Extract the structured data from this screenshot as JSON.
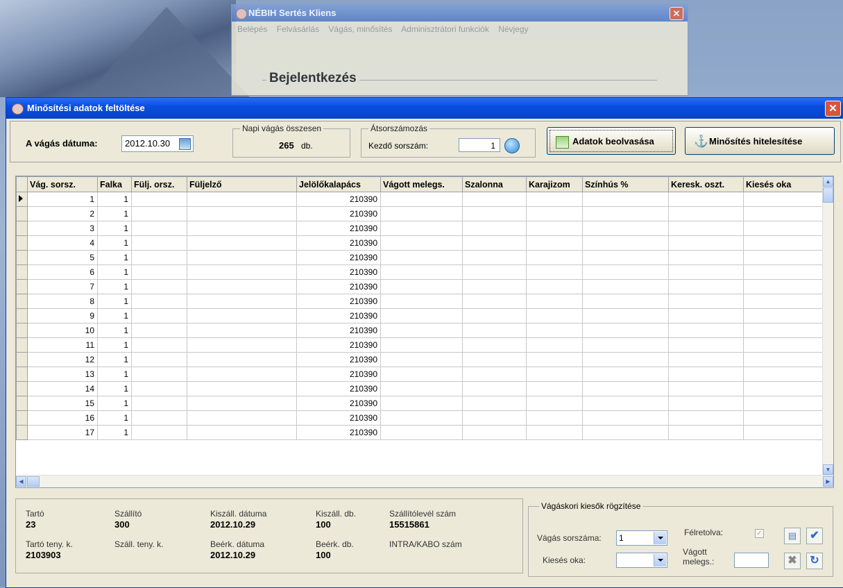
{
  "bg_window": {
    "title": "NÉBIH Sertés Kliens",
    "menu": [
      "Belépés",
      "Felvásárlás",
      "Vágás, minősítés",
      "Adminisztrátori funkciók",
      "Névjegy"
    ],
    "login_title": "Bejelentkezés",
    "close": "✕"
  },
  "window": {
    "title": "Minősítési adatok feltöltése",
    "close": "✕"
  },
  "toolbar": {
    "date_label": "A vágás dátuma:",
    "date_value": "2012.10.30",
    "daily_title": "Napi vágás összesen",
    "daily_value": "265",
    "daily_unit": "db.",
    "renum_title": "Átsorszámozás",
    "start_label": "Kezdő sorszám:",
    "start_value": "1",
    "read_button": "Adatok beolvasása",
    "auth_button": "Minősítés hitelesítése"
  },
  "grid": {
    "columns": [
      "Vág. sorsz.",
      "Falka",
      "Fülj. orsz.",
      "Füljelző",
      "Jelölőkalapács",
      "Vágott melegs.",
      "Szalonna",
      "Karajizom",
      "Színhús %",
      "Keresk. oszt.",
      "Kiesés oka"
    ],
    "rows": [
      {
        "n": "1",
        "f": "1",
        "j": "210390"
      },
      {
        "n": "2",
        "f": "1",
        "j": "210390"
      },
      {
        "n": "3",
        "f": "1",
        "j": "210390"
      },
      {
        "n": "4",
        "f": "1",
        "j": "210390"
      },
      {
        "n": "5",
        "f": "1",
        "j": "210390"
      },
      {
        "n": "6",
        "f": "1",
        "j": "210390"
      },
      {
        "n": "7",
        "f": "1",
        "j": "210390"
      },
      {
        "n": "8",
        "f": "1",
        "j": "210390"
      },
      {
        "n": "9",
        "f": "1",
        "j": "210390"
      },
      {
        "n": "10",
        "f": "1",
        "j": "210390"
      },
      {
        "n": "11",
        "f": "1",
        "j": "210390"
      },
      {
        "n": "12",
        "f": "1",
        "j": "210390"
      },
      {
        "n": "13",
        "f": "1",
        "j": "210390"
      },
      {
        "n": "14",
        "f": "1",
        "j": "210390"
      },
      {
        "n": "15",
        "f": "1",
        "j": "210390"
      },
      {
        "n": "16",
        "f": "1",
        "j": "210390"
      },
      {
        "n": "17",
        "f": "1",
        "j": "210390"
      }
    ]
  },
  "info": {
    "tarto_label": "Tartó",
    "tarto_value": "23",
    "szallito_label": "Szállító",
    "szallito_value": "300",
    "kiszall_datum_label": "Kiszáll. dátuma",
    "kiszall_datum_value": "2012.10.29",
    "kiszall_db_label": "Kiszáll. db.",
    "kiszall_db_value": "100",
    "szallitolevel_label": "Szállítólevél szám",
    "szallitolevel_value": "15515861",
    "tarto_teny_label": "Tartó teny. k.",
    "tarto_teny_value": "2103903",
    "szall_teny_label": "Száll. teny. k.",
    "beerk_datum_label": "Beérk. dátuma",
    "beerk_datum_value": "2012.10.29",
    "beerk_db_label": "Beérk. db.",
    "beerk_db_value": "100",
    "intra_label": "INTRA/KABO szám"
  },
  "losses": {
    "title": "Vágáskori kiesők rögzítése",
    "seq_label": "Vágás sorszáma:",
    "seq_value": "1",
    "reason_label": "Kiesés oka:",
    "aside_label": "Félretolva:",
    "weight_label_1": "Vágott",
    "weight_label_2": "melegs.:"
  }
}
